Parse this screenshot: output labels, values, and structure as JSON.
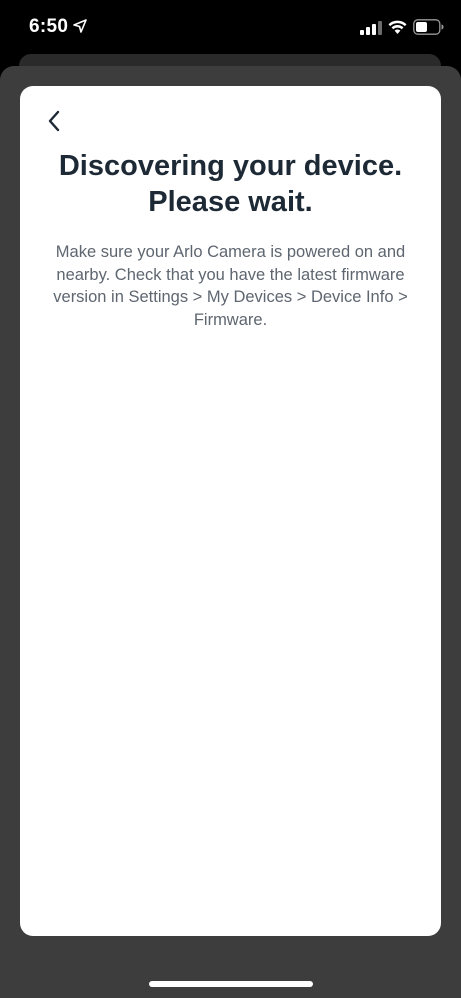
{
  "status_bar": {
    "time": "6:50",
    "icons": [
      "location-arrow-icon",
      "cellular-signal-icon",
      "wifi-icon",
      "battery-icon"
    ]
  },
  "card": {
    "back_icon": "chevron-left-icon",
    "title_line1": "Discovering your device.",
    "title_line2": "Please wait.",
    "description": "Make sure your Arlo Camera is powered on and nearby. Check that you have the latest firmware version in Settings > My Devices > Device Info > Firmware."
  },
  "colors": {
    "title": "#1d2a36",
    "description": "#5e6670",
    "card_background": "#ffffff",
    "backdrop": "#3d3d3d"
  }
}
